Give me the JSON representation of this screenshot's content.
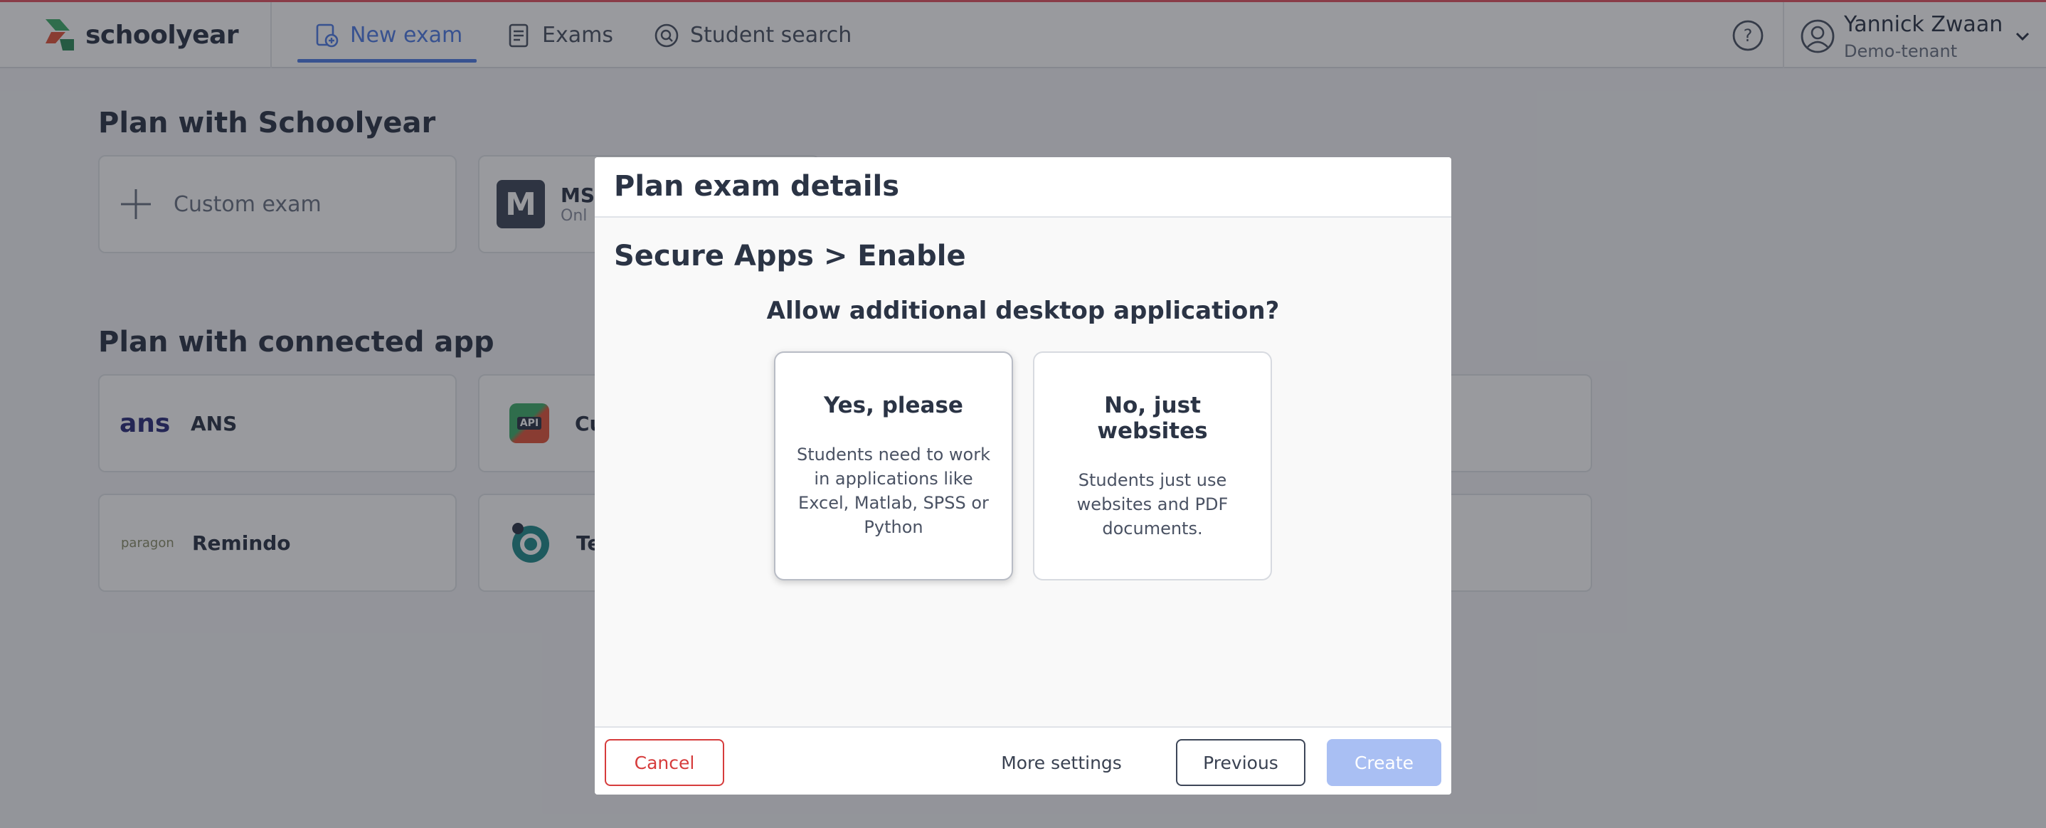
{
  "app": {
    "name": "schoolyear"
  },
  "nav": {
    "items": [
      {
        "label": "New exam",
        "icon": "new-exam-icon",
        "active": true
      },
      {
        "label": "Exams",
        "icon": "exams-icon",
        "active": false
      },
      {
        "label": "Student search",
        "icon": "search-icon",
        "active": false
      }
    ]
  },
  "user": {
    "name": "Yannick Zwaan",
    "tenant": "Demo-tenant"
  },
  "background": {
    "plan_title": "Plan with Schoolyear",
    "custom_exam": "Custom exam",
    "ms_card_label": "MS",
    "ms_card_sub": "Onl",
    "connected_title": "Plan with connected app",
    "apps": [
      {
        "label": "ANS",
        "logo": "ans"
      },
      {
        "label": "Cu",
        "logo": "API"
      },
      {
        "label": "Remindo",
        "logo": "paragon"
      },
      {
        "label": "Te",
        "logo": ""
      }
    ]
  },
  "modal": {
    "title": "Plan exam details",
    "breadcrumb": "Secure Apps > Enable",
    "question": "Allow additional desktop application?",
    "options": [
      {
        "title": "Yes, please",
        "description": "Students need to work in applications like Excel, Matlab, SPSS or Python",
        "selected": true
      },
      {
        "title": "No, just websites",
        "description": "Students just use websites and PDF documents.",
        "selected": false
      }
    ],
    "footer": {
      "cancel": "Cancel",
      "more_settings": "More settings",
      "previous": "Previous",
      "create": "Create"
    }
  },
  "colors": {
    "accent": "#4f7de6",
    "danger": "#d63c3c",
    "create_disabled": "#a9bff3",
    "brand_top_border": "#e25563"
  }
}
